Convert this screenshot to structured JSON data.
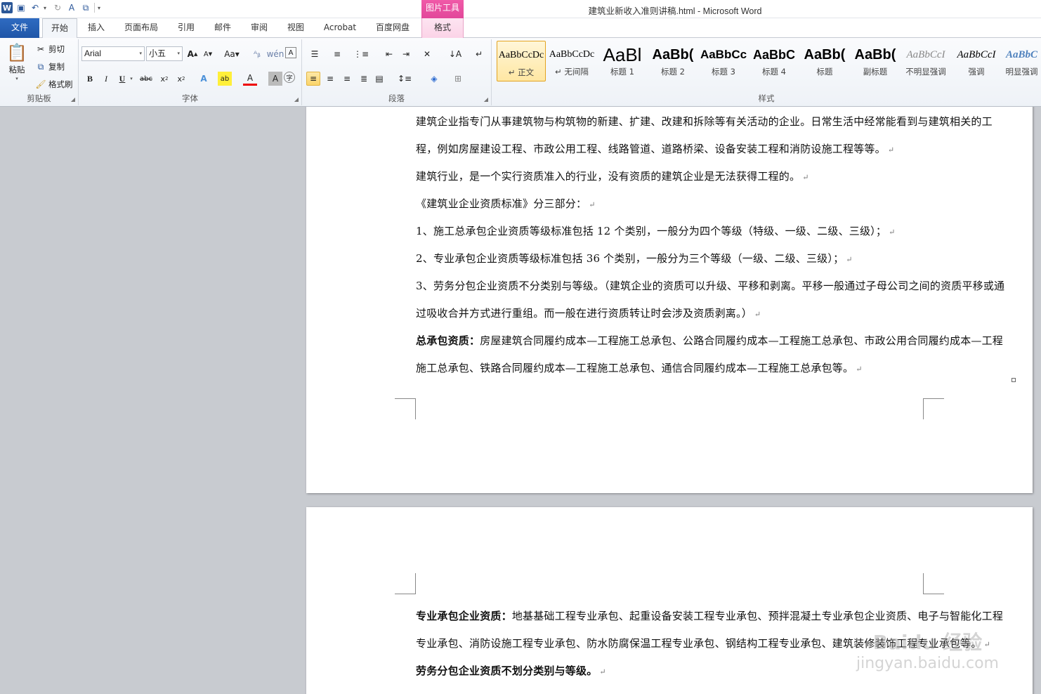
{
  "window": {
    "title": "建筑业新收入准则讲稿.html  -  Microsoft Word",
    "context_group": "图片工具"
  },
  "quick_access": {
    "app_icon": "word-icon",
    "icons": [
      "save-icon",
      "undo-icon",
      "redo-icon",
      "spelling-icon",
      "copy-format-icon"
    ]
  },
  "tabs": [
    {
      "label": "文件"
    },
    {
      "label": "开始"
    },
    {
      "label": "插入"
    },
    {
      "label": "页面布局"
    },
    {
      "label": "引用"
    },
    {
      "label": "邮件"
    },
    {
      "label": "审阅"
    },
    {
      "label": "视图"
    },
    {
      "label": "Acrobat"
    },
    {
      "label": "百度网盘"
    },
    {
      "label": "格式"
    }
  ],
  "clipboard": {
    "label": "剪贴板",
    "paste": "粘贴",
    "cut": "剪切",
    "copy": "复制",
    "format_painter": "格式刷"
  },
  "font": {
    "label": "字体",
    "font_name": "Arial",
    "font_size": "小五"
  },
  "paragraph": {
    "label": "段落"
  },
  "styles": {
    "label": "样式",
    "items": [
      {
        "sample": "AaBbCcDc",
        "name": "↵ 正文"
      },
      {
        "sample": "AaBbCcDc",
        "name": "↵ 无间隔"
      },
      {
        "sample": "AaBl",
        "name": "标题 1"
      },
      {
        "sample": "AaBb(",
        "name": "标题 2"
      },
      {
        "sample": "AaBbCc",
        "name": "标题 3"
      },
      {
        "sample": "AaBbC",
        "name": "标题 4"
      },
      {
        "sample": "AaBb(",
        "name": "标题"
      },
      {
        "sample": "AaBb(",
        "name": "副标题"
      },
      {
        "sample": "AaBbCcI",
        "name": "不明显强调"
      },
      {
        "sample": "AaBbCcI",
        "name": "强调"
      },
      {
        "sample": "AaBbC",
        "name": "明显强调"
      }
    ]
  },
  "document": {
    "page1": [
      {
        "text": "建筑企业指专门从事建筑物与构筑物的新建、扩建、改建和拆除等有关活动的企业。日常生活中经常能看到与建筑相关的工程，例如房屋建设工程、市政公用工程、线路管道、道路桥梁、设备安装工程和消防设施工程等等。"
      },
      {
        "text": "建筑行业，是一个实行资质准入的行业，没有资质的建筑企业是无法获得工程的。"
      },
      {
        "text": "《建筑业企业资质标准》分三部分："
      },
      {
        "text": "1、施工总承包企业资质等级标准包括 12 个类别，一般分为四个等级（特级、一级、二级、三级）；"
      },
      {
        "text": "2、专业承包企业资质等级标准包括 36 个类别，一般分为三个等级（一级、二级、三级）；"
      },
      {
        "text": "3、劳务分包企业资质不分类别与等级。（建筑企业的资质可以升级、平移和剥离。平移一般通过子母公司之间的资质平移或通过吸收合并方式进行重组。而一般在进行资质转让时会涉及资质剥离。）"
      },
      {
        "bold": "总承包资质：",
        "text": "房屋建筑合同履约成本—工程施工总承包、公路合同履约成本—工程施工总承包、市政公用合同履约成本—工程施工总承包、铁路合同履约成本—工程施工总承包、通信合同履约成本—工程施工总承包等。"
      }
    ],
    "page2": [
      {
        "bold": "专业承包企业资质：",
        "text": "地基基础工程专业承包、起重设备安装工程专业承包、预拌混凝土专业承包企业资质、电子与智能化工程专业承包、消防设施工程专业承包、防水防腐保温工程专业承包、钢结构工程专业承包、建筑装修装饰工程专业承包等。"
      },
      {
        "bold": "劳务分包企业资质不划分类别与等级。",
        "text": ""
      }
    ],
    "pilcrow": "↵"
  },
  "watermark": {
    "line1": "Baidu 经验",
    "line2": "jingyan.baidu.com"
  }
}
